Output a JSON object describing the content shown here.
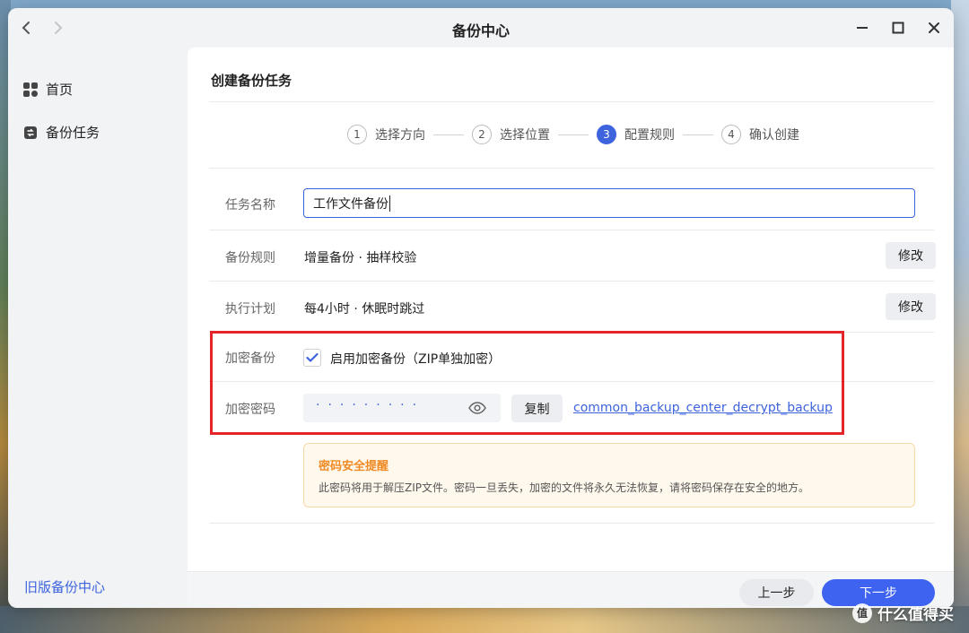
{
  "window": {
    "title": "备份中心"
  },
  "sidebar": {
    "items": [
      {
        "label": "首页",
        "icon": "grid-icon"
      },
      {
        "label": "备份任务",
        "icon": "backup-task-icon"
      }
    ],
    "old_version_link": "旧版备份中心"
  },
  "main": {
    "title": "创建备份任务",
    "steps": [
      {
        "num": "1",
        "label": "选择方向",
        "active": false
      },
      {
        "num": "2",
        "label": "选择位置",
        "active": false
      },
      {
        "num": "3",
        "label": "配置规则",
        "active": true
      },
      {
        "num": "4",
        "label": "确认创建",
        "active": false
      }
    ],
    "task_name": {
      "label": "任务名称",
      "value": "工作文件备份"
    },
    "backup_rule": {
      "label": "备份规则",
      "value": "增量备份 · 抽样校验",
      "button": "修改"
    },
    "schedule": {
      "label": "执行计划",
      "value": "每4小时 · 休眠时跳过",
      "button": "修改"
    },
    "encryption": {
      "label": "加密备份",
      "checkbox_label": "启用加密备份（ZIP单独加密）",
      "checked": true
    },
    "password": {
      "label": "加密密码",
      "masked": "·········",
      "copy_button": "复制",
      "value_link": "common_backup_center_decrypt_backup"
    },
    "warning": {
      "title": "密码安全提醒",
      "text": "此密码将用于解压ZIP文件。密码一旦丢失，加密的文件将永久无法恢复，请将密码保存在安全的地方。"
    }
  },
  "footer": {
    "prev_button": "上一步",
    "next_button": "下一步"
  },
  "watermark": {
    "logo_text": "值",
    "text": "什么值得买"
  },
  "colors": {
    "accent": "#3d63dd",
    "highlight_box": "#e3242b",
    "warning_title": "#f08a24"
  }
}
